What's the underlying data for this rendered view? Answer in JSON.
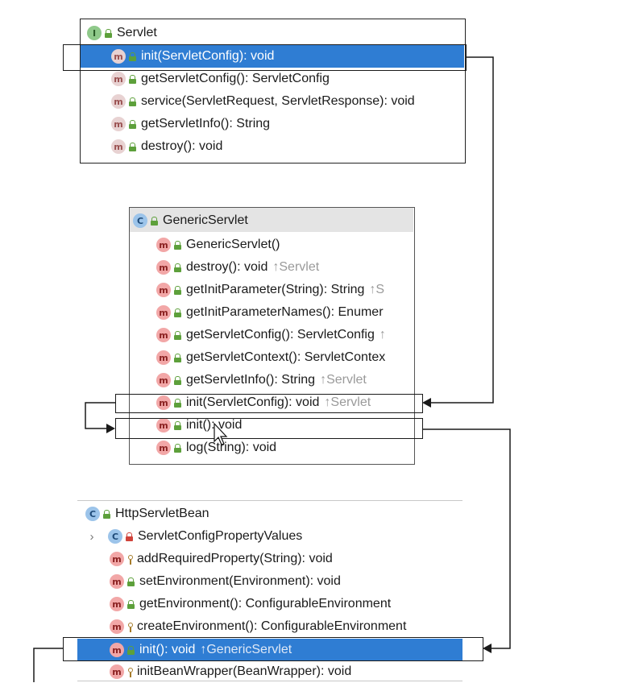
{
  "servlet": {
    "title": "Servlet",
    "badge": "I",
    "methods": [
      {
        "label": "init(ServletConfig): void",
        "badge": "m"
      },
      {
        "label": "getServletConfig(): ServletConfig",
        "badge": "m"
      },
      {
        "label": "service(ServletRequest, ServletResponse): void",
        "badge": "m"
      },
      {
        "label": "getServletInfo(): String",
        "badge": "m"
      },
      {
        "label": "destroy(): void",
        "badge": "m"
      }
    ]
  },
  "generic": {
    "title": "GenericServlet",
    "badge": "C",
    "methods": [
      {
        "label": "GenericServlet()",
        "inherited": ""
      },
      {
        "label": "destroy(): void",
        "inherited": "↑Servlet"
      },
      {
        "label": "getInitParameter(String): String",
        "inherited": "↑S"
      },
      {
        "label": "getInitParameterNames(): Enumer",
        "inherited": ""
      },
      {
        "label": "getServletConfig(): ServletConfig",
        "inherited": "↑"
      },
      {
        "label": "getServletContext(): ServletContex",
        "inherited": ""
      },
      {
        "label": "getServletInfo(): String",
        "inherited": "↑Servlet"
      },
      {
        "label": "init(ServletConfig): void",
        "inherited": "↑Servlet"
      },
      {
        "label": "init(): void",
        "inherited": ""
      },
      {
        "label": "log(String): void",
        "inherited": ""
      }
    ]
  },
  "httpbean": {
    "title": "HttpServletBean",
    "badge": "C",
    "items": [
      {
        "label": "ServletConfigPropertyValues",
        "badge": "C",
        "inherited": ""
      },
      {
        "label": "addRequiredProperty(String): void",
        "badge": "m",
        "inherited": ""
      },
      {
        "label": "setEnvironment(Environment): void",
        "badge": "m",
        "inherited": ""
      },
      {
        "label": "getEnvironment(): ConfigurableEnvironment",
        "badge": "m",
        "inherited": ""
      },
      {
        "label": "createEnvironment(): ConfigurableEnvironment",
        "badge": "m",
        "inherited": ""
      },
      {
        "label": "init(): void",
        "badge": "m",
        "inherited": "↑GenericServlet"
      },
      {
        "label": "initBeanWrapper(BeanWrapper): void",
        "badge": "m",
        "inherited": ""
      }
    ]
  },
  "colors": {
    "selection": "#2f7dd3",
    "public_lock": "#5da03b",
    "private_lock": "#d0423a",
    "method_badge": "#f2a7a7",
    "class_badge": "#9cc4ea",
    "interface_badge": "#8fc98a"
  },
  "icons": {
    "expand": "chevron-right-icon",
    "cursor": "mouse-pointer-icon"
  }
}
